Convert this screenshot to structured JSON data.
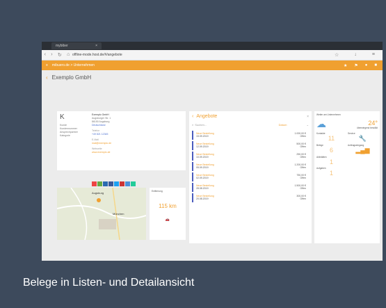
{
  "browser": {
    "tab_title": "mybiber",
    "url": "offline-mode.host.de/#/angebote",
    "nav_icons": [
      "back-icon",
      "forward-icon",
      "reload-icon",
      "home-icon"
    ]
  },
  "app": {
    "breadcrumb": "mibuero.de > Unternehmen",
    "company_title": "Exemplo GmbH"
  },
  "contact": {
    "initial": "K",
    "left_labels": [
      "Kunde",
      "Kundennummer",
      "Ansprechpartner",
      "Kategorie"
    ],
    "name": "Exemplo GmbH",
    "address": [
      "Augsburger Str. 1",
      "86150 Augsburg",
      "Deutschland"
    ],
    "phone_label": "Telefon",
    "phone": "+49 821 12345",
    "email_label": "E-Mail",
    "email": "mail@exemplo.de",
    "website_label": "Webseite",
    "website": "www.exemplo.de",
    "distance_label": "Entfernung",
    "distance_value": "115 km"
  },
  "map": {
    "labels": [
      "Augsburg",
      "München"
    ]
  },
  "offers": {
    "title": "Angebote",
    "search_placeholder": "Suchen...",
    "sort": "Datum",
    "rows": [
      {
        "title": "Neue Bestellung",
        "date": "15.09.2019",
        "amount": "1.000,00 €",
        "status": "Offen"
      },
      {
        "title": "Neue Bestellung",
        "date": "12.09.2019",
        "amount": "500,00 €",
        "status": "Offen"
      },
      {
        "title": "Neue Bestellung",
        "date": "10.09.2019",
        "amount": "250,00 €",
        "status": "Offen"
      },
      {
        "title": "Neue Bestellung",
        "date": "05.09.2019",
        "amount": "1.200,00 €",
        "status": "Offen"
      },
      {
        "title": "Neue Bestellung",
        "date": "02.09.2019",
        "amount": "750,00 €",
        "status": "Offen"
      },
      {
        "title": "Neue Bestellung",
        "date": "28.08.2019",
        "amount": "1.500,00 €",
        "status": "Offen"
      },
      {
        "title": "Neue Bestellung",
        "date": "20.08.2019",
        "amount": "300,00 €",
        "status": "Offen"
      }
    ]
  },
  "widgets": {
    "weather_title": "Wetter am Unternehmen",
    "weather_temp": "24°",
    "weather_desc": "überwiegend bewölkt",
    "contacts_label": "Kontakte",
    "contacts_value": "11",
    "service_label": "Service",
    "offers_label": "Belege",
    "offers_value": "6",
    "revenue_label": "Auftragseingang",
    "activities_label": "Aktivitäten",
    "activities_value": "1",
    "tasks_label": "Aufgaben",
    "tasks_value": "1"
  },
  "caption": "Belege in Listen- und Detailansicht"
}
